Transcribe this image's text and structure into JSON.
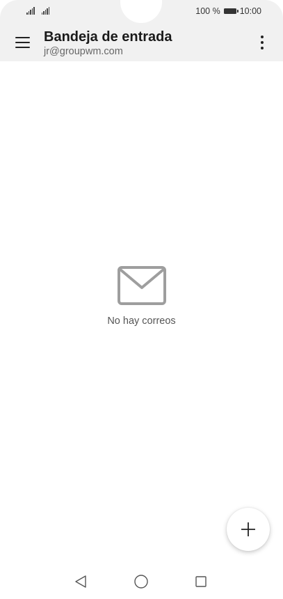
{
  "status_bar": {
    "battery_text": "100 %",
    "time": "10:00"
  },
  "app_bar": {
    "title": "Bandeja de entrada",
    "subtitle": "jr@groupwm.com"
  },
  "empty_state": {
    "message": "No hay correos"
  },
  "icons": {
    "menu": "menu-icon",
    "overflow": "more-vert-icon",
    "mail": "envelope-icon",
    "compose": "plus-icon",
    "nav_back": "triangle-back-icon",
    "nav_home": "circle-home-icon",
    "nav_recents": "square-recents-icon"
  },
  "colors": {
    "header_bg": "#f1f1f1",
    "icon_grey": "#9e9e9e",
    "text_primary": "#1a1a1a",
    "text_secondary": "#666666"
  }
}
